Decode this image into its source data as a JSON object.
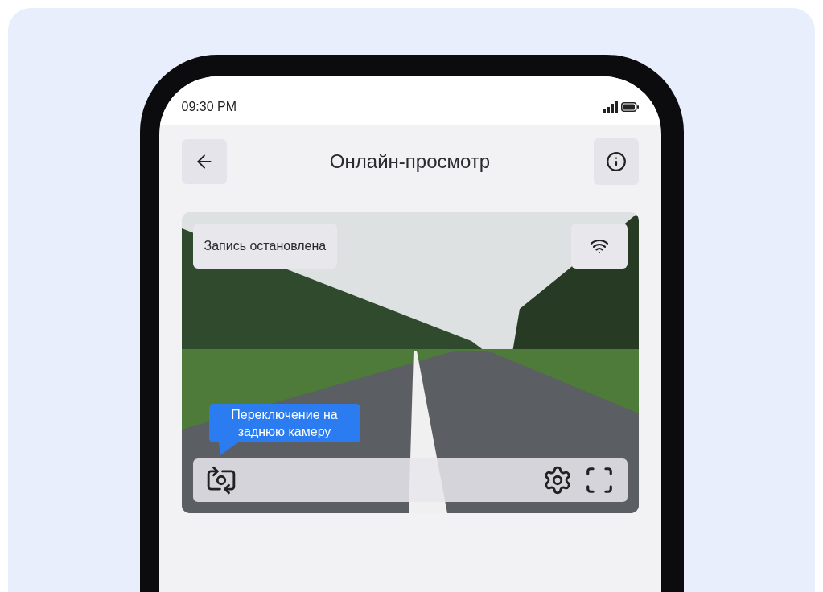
{
  "status_bar": {
    "time": "09:30 PM"
  },
  "header": {
    "title": "Онлайн-просмотр"
  },
  "video": {
    "status": "Запись остановлена",
    "tooltip": "Переключение на заднюю камеру"
  }
}
